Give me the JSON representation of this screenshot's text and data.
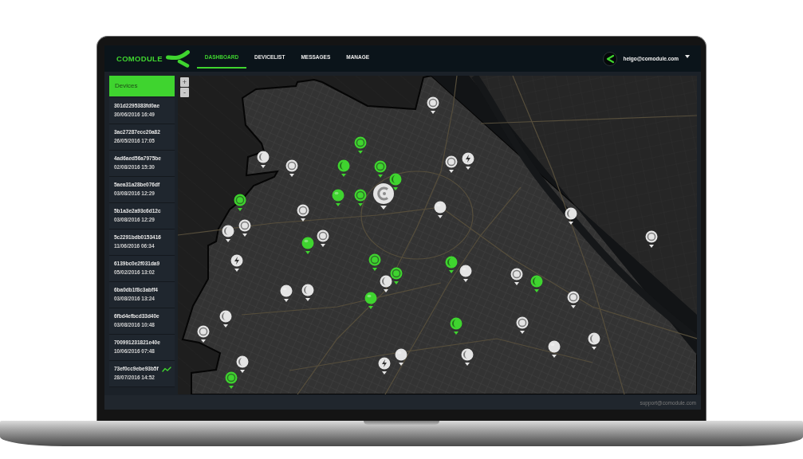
{
  "header": {
    "logo": "COMODULE",
    "tabs": [
      {
        "label": "DASHBOARD",
        "selected": true
      },
      {
        "label": "DEVICELIST",
        "selected": false
      },
      {
        "label": "MESSAGES",
        "selected": false
      },
      {
        "label": "MANAGE",
        "selected": false
      }
    ],
    "user": {
      "email": "heigo@comodule.com"
    }
  },
  "sidebar": {
    "title": "Devices",
    "items": [
      {
        "id": "301d2295383fd0ae",
        "time": "30/06/2016 16:49",
        "trend": false
      },
      {
        "id": "3ac27287ecc20a82",
        "time": "26/05/2016 17:05",
        "trend": false
      },
      {
        "id": "4ad6aed56a7975be",
        "time": "02/08/2016 15:30",
        "trend": false
      },
      {
        "id": "5aea31a28be076df",
        "time": "03/08/2016 12:29",
        "trend": false
      },
      {
        "id": "5b1a3e2a93c6d12c",
        "time": "03/08/2016 12:29",
        "trend": false
      },
      {
        "id": "5c2291bdb0153416",
        "time": "11/06/2016 06:34",
        "trend": false
      },
      {
        "id": "6139bc0e2f031da9",
        "time": "05/02/2016 13:02",
        "trend": false
      },
      {
        "id": "6ba0db1f8c3abff4",
        "time": "03/08/2016 13:24",
        "trend": false
      },
      {
        "id": "6fbd4efbcd33d40e",
        "time": "03/08/2016 10:48",
        "trend": false
      },
      {
        "id": "700991231821e40e",
        "time": "10/06/2016 07:48",
        "trend": false
      },
      {
        "id": "73ef0cc9ebe93b5f",
        "time": "28/07/2016 14:52",
        "trend": true
      }
    ]
  },
  "map": {
    "zoom_buttons": [
      "+",
      "-"
    ],
    "markers": [
      {
        "kind": "ring",
        "color": "#e4e4e4"
      },
      {
        "kind": "ring",
        "color": "#3fd42f"
      },
      {
        "kind": "crescent",
        "color": "#e4e4e4"
      },
      {
        "kind": "bolt",
        "color": "#e4e4e4"
      },
      {
        "kind": "ring",
        "color": "#e4e4e4"
      },
      {
        "kind": "ring",
        "color": "#e4e4e4"
      },
      {
        "kind": "crescent",
        "color": "#3fd42f"
      },
      {
        "kind": "ring",
        "color": "#3fd42f"
      },
      {
        "kind": "crescent",
        "color": "#3fd42f"
      },
      {
        "kind": "cluster",
        "color": "#e4e4e4"
      },
      {
        "kind": "dot",
        "color": "#3fd42f"
      },
      {
        "kind": "ring",
        "color": "#3fd42f"
      },
      {
        "kind": "ring",
        "color": "#3fd42f"
      },
      {
        "kind": "dot",
        "color": "#e4e4e4"
      },
      {
        "kind": "ring",
        "color": "#e4e4e4"
      },
      {
        "kind": "crescent",
        "color": "#e4e4e4"
      },
      {
        "kind": "ring",
        "color": "#e4e4e4"
      },
      {
        "kind": "crescent",
        "color": "#e4e4e4"
      },
      {
        "kind": "ring",
        "color": "#e4e4e4"
      },
      {
        "kind": "ring",
        "color": "#e4e4e4"
      },
      {
        "kind": "dot",
        "color": "#3fd42f"
      },
      {
        "kind": "ring",
        "color": "#3fd42f"
      },
      {
        "kind": "bolt",
        "color": "#e4e4e4"
      },
      {
        "kind": "crescent",
        "color": "#3fd42f"
      },
      {
        "kind": "dot",
        "color": "#e4e4e4"
      },
      {
        "kind": "ring",
        "color": "#3fd42f"
      },
      {
        "kind": "ring",
        "color": "#e4e4e4"
      },
      {
        "kind": "crescent",
        "color": "#e4e4e4"
      },
      {
        "kind": "crescent",
        "color": "#3fd42f"
      },
      {
        "kind": "crescent",
        "color": "#e4e4e4"
      },
      {
        "kind": "dot",
        "color": "#e4e4e4"
      },
      {
        "kind": "ring",
        "color": "#e4e4e4"
      },
      {
        "kind": "dot",
        "color": "#3fd42f"
      },
      {
        "kind": "crescent",
        "color": "#e4e4e4"
      },
      {
        "kind": "ring",
        "color": "#e4e4e4"
      },
      {
        "kind": "crescent",
        "color": "#3fd42f"
      },
      {
        "kind": "ring",
        "color": "#e4e4e4"
      },
      {
        "kind": "crescent",
        "color": "#e4e4e4"
      },
      {
        "kind": "dot",
        "color": "#e4e4e4"
      },
      {
        "kind": "dot",
        "color": "#e4e4e4"
      },
      {
        "kind": "crescent",
        "color": "#e4e4e4"
      },
      {
        "kind": "crescent",
        "color": "#e4e4e4"
      },
      {
        "kind": "bolt",
        "color": "#e4e4e4"
      },
      {
        "kind": "ring",
        "color": "#3fd42f"
      }
    ]
  },
  "footer": {
    "support_email": "support@comodule.com"
  }
}
